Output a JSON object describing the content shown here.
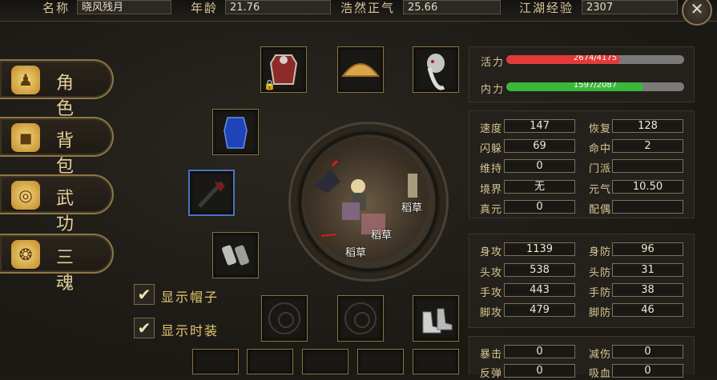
{
  "header": {
    "name_label": "名称",
    "name_value": "晓风残月",
    "age_label": "年龄",
    "age_value": "21.76",
    "righteous_label": "浩然正气",
    "righteous_value": "25.66",
    "exp_label": "江湖经验",
    "exp_value": "2307",
    "close_icon": "close-icon"
  },
  "menu": [
    {
      "label": "角色",
      "icon": "character-icon",
      "glyph": "♟"
    },
    {
      "label": "背包",
      "icon": "bag-icon",
      "glyph": "◼"
    },
    {
      "label": "武功",
      "icon": "scroll-icon",
      "glyph": "◎"
    },
    {
      "label": "三魂",
      "icon": "soul-icon",
      "glyph": "❂"
    }
  ],
  "options": {
    "show_hat": "显示帽子",
    "show_fashion": "显示时装"
  },
  "scene": {
    "npc_name_1": "稻草",
    "npc_name_2": "稻草",
    "npc_name_3": "稻草"
  },
  "vitals": {
    "vigor_label": "活力",
    "vigor_text": "2674/4175",
    "vigor_ratio": 0.64,
    "vigor_color": "#e23a3a",
    "inner_label": "内力",
    "inner_text": "1597/2087",
    "inner_ratio": 0.77,
    "inner_color": "#3bb83b"
  },
  "stats1": {
    "speed_label": "速度",
    "speed": "147",
    "recover_label": "恢复",
    "recover": "128",
    "dodge_label": "闪躲",
    "dodge": "69",
    "hit_label": "命中",
    "hit": "2",
    "maintain_label": "维持",
    "maintain": "0",
    "sect_label": "门派",
    "sect": "",
    "realm_label": "境界",
    "realm": "无",
    "yuanqi_label": "元气",
    "yuanqi": "10.50",
    "zhenyuan_label": "真元",
    "zhenyuan": "0",
    "spouse_label": "配偶",
    "spouse": ""
  },
  "stats2": {
    "body_atk_label": "身攻",
    "body_atk": "1139",
    "body_def_label": "身防",
    "body_def": "96",
    "head_atk_label": "头攻",
    "head_atk": "538",
    "head_def_label": "头防",
    "head_def": "31",
    "hand_atk_label": "手攻",
    "hand_atk": "443",
    "hand_def_label": "手防",
    "hand_def": "38",
    "foot_atk_label": "脚攻",
    "foot_atk": "479",
    "foot_def_label": "脚防",
    "foot_def": "46"
  },
  "stats3": {
    "crit_label": "暴击",
    "crit": "0",
    "dmg_reduce_label": "减伤",
    "dmg_reduce": "0",
    "reflect_label": "反弹",
    "reflect": "0",
    "lifesteal_label": "吸血",
    "lifesteal": "0"
  }
}
